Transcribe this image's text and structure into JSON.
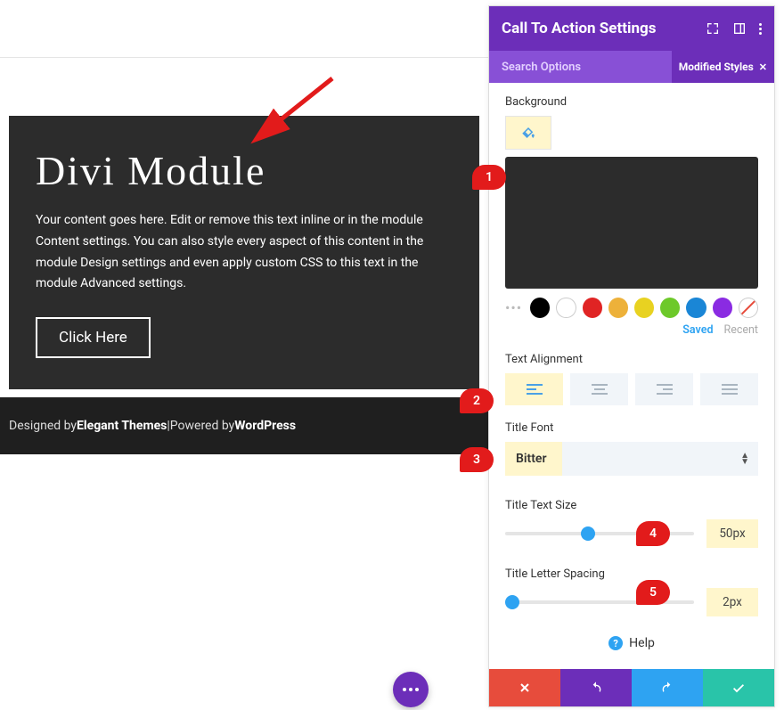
{
  "content": {
    "title": "Divi Module",
    "body": "Your content goes here. Edit or remove this text inline or in the module Content settings. You can also style every aspect of this content in the module Design settings and even apply custom CSS to this text in the module Advanced settings.",
    "button": "Click Here"
  },
  "footer": {
    "designed_prefix": "Designed by ",
    "designed_by": "Elegant Themes",
    "sep": " | ",
    "powered_prefix": "Powered by ",
    "powered_by": "WordPress"
  },
  "panel": {
    "header_title": "Call To Action Settings",
    "search_placeholder": "Search Options",
    "filter_chip": "Modified Styles",
    "labels": {
      "background": "Background",
      "text_alignment": "Text Alignment",
      "title_font": "Title Font",
      "title_text_size": "Title Text Size",
      "title_letter_spacing": "Title Letter Spacing"
    },
    "swatches": [
      "#000000",
      "#ffffff",
      "#e02424",
      "#edb13a",
      "#f0d02b",
      "#6dc92a",
      "#1a86d6",
      "#8a2be2"
    ],
    "saved_recent": {
      "saved": "Saved",
      "recent": "Recent"
    },
    "title_font_value": "Bitter",
    "title_text_size_value": "50px",
    "title_letter_spacing_value": "2px",
    "help_label": "Help"
  },
  "annotations": {
    "b1": "1",
    "b2": "2",
    "b3": "3",
    "b4": "4",
    "b5": "5"
  }
}
